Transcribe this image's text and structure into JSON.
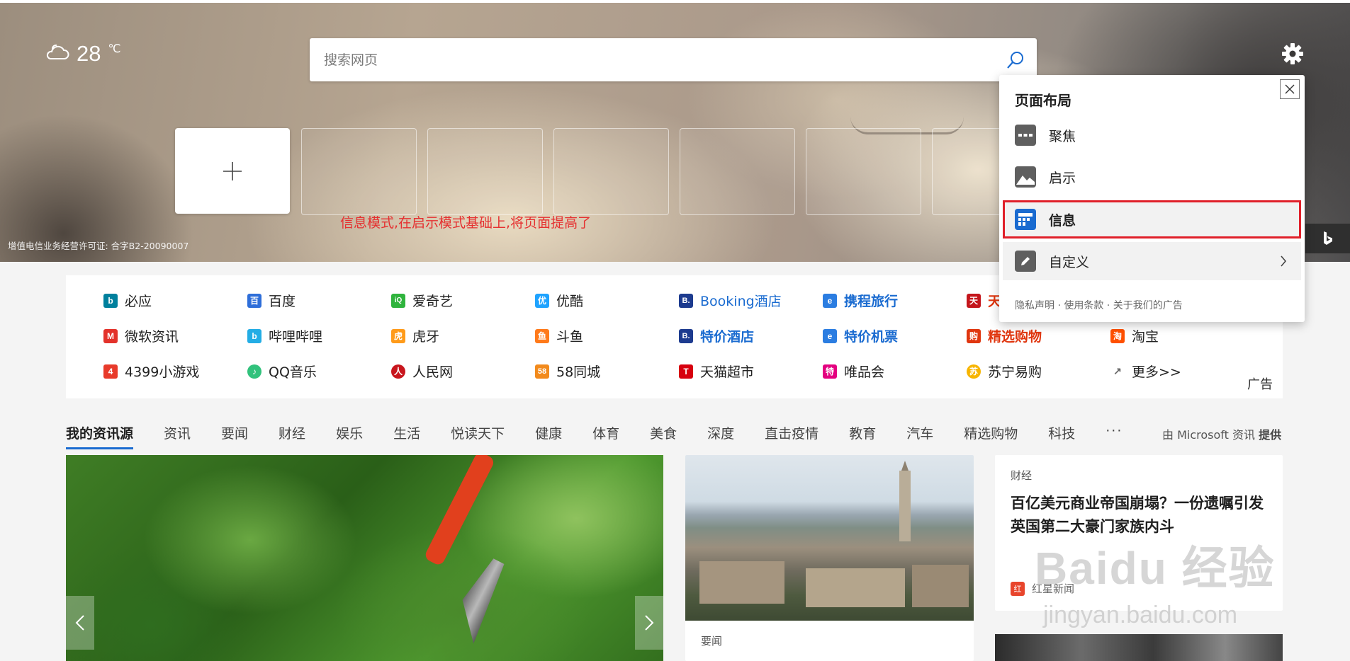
{
  "weather": {
    "temperature": "28",
    "unit": "℃",
    "icon": "partly-cloudy-icon"
  },
  "search": {
    "placeholder": "搜索网页",
    "icon": "search-icon"
  },
  "settings": {
    "icon": "gear-icon"
  },
  "annotation_text": "信息模式,在启示模式基础上,将页面提高了",
  "license_text": "增值电信业务经营许可证: 合字B2-20090007",
  "quick_links": [
    {
      "label": "必应",
      "color": "#00809d",
      "glyph": "b"
    },
    {
      "label": "百度",
      "color": "#2e6ed9",
      "glyph": "百"
    },
    {
      "label": "爱奇艺",
      "color": "#2fb43d",
      "glyph": "iQ"
    },
    {
      "label": "优酷",
      "color": "#1fa3ff",
      "glyph": "优"
    },
    {
      "label": "Booking酒店",
      "color": "#1d3b8f",
      "glyph": "B."
    },
    {
      "label": "携程旅行",
      "color": "#2b7de1",
      "glyph": "e"
    },
    {
      "label": "天",
      "color": "#c4161c",
      "glyph": "天"
    },
    {
      "label": "微软资讯",
      "color": "#e3322b",
      "glyph": "M"
    },
    {
      "label": "哔哩哔哩",
      "color": "#23ade5",
      "glyph": "b"
    },
    {
      "label": "虎牙",
      "color": "#ff9b1a",
      "glyph": "虎"
    },
    {
      "label": "斗鱼",
      "color": "#ff7a1a",
      "glyph": "鱼"
    },
    {
      "label": "特价酒店",
      "color": "#1d3b8f",
      "glyph": "B."
    },
    {
      "label": "特价机票",
      "color": "#2b7de1",
      "glyph": "e"
    },
    {
      "label": "精选购物",
      "color": "#e0360f",
      "glyph": "购"
    },
    {
      "label": "淘宝",
      "color": "#ff5000",
      "glyph": "淘"
    },
    {
      "label": "4399小游戏",
      "color": "#e83a2a",
      "glyph": "4"
    },
    {
      "label": "QQ音乐",
      "color": "#31c27c",
      "glyph": "♪"
    },
    {
      "label": "人民网",
      "color": "#c8161d",
      "glyph": "人"
    },
    {
      "label": "58同城",
      "color": "#f28a1c",
      "glyph": "58"
    },
    {
      "label": "天猫超市",
      "color": "#d7000f",
      "glyph": "T"
    },
    {
      "label": "唯品会",
      "color": "#e4007f",
      "glyph": "特"
    },
    {
      "label": "苏宁易购",
      "color": "#f7b500",
      "glyph": "苏"
    },
    {
      "label": "更多>>",
      "color": "#666666",
      "glyph": "↗"
    }
  ],
  "ad_label": "广告",
  "tabs": [
    "我的资讯源",
    "资讯",
    "要闻",
    "财经",
    "娱乐",
    "生活",
    "悦读天下",
    "健康",
    "体育",
    "美食",
    "深度",
    "直击疫情",
    "教育",
    "汽车",
    "精选购物",
    "科技",
    "···"
  ],
  "provider": {
    "prefix": "由 Microsoft 资讯",
    "suffix": "提供"
  },
  "cards": {
    "mid_category": "要闻",
    "right_category": "财经",
    "right_title": "百亿美元商业帝国崩塌？一份遗嘱引发英国第二大豪门家族内斗",
    "right_source": "红星新闻",
    "right_source_icon": "红"
  },
  "watermark": {
    "line1": "Baidu 经验",
    "line2": "jingyan.baidu.com"
  },
  "layout_popup": {
    "title": "页面布局",
    "options": [
      {
        "label": "聚焦",
        "icon": "focus-layout-icon"
      },
      {
        "label": "启示",
        "icon": "inspire-layout-icon"
      },
      {
        "label": "信息",
        "icon": "info-layout-icon"
      },
      {
        "label": "自定义",
        "icon": "pencil-icon"
      }
    ],
    "footer": "隐私声明 · 使用条款 · 关于我们的广告"
  }
}
